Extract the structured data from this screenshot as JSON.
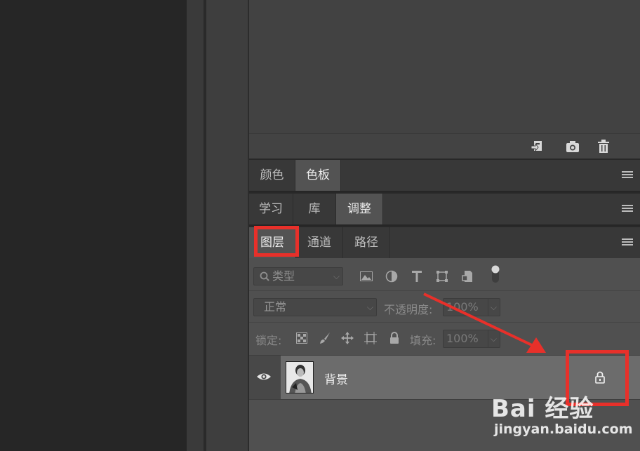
{
  "history_footer": {
    "icons": [
      "new-snapshot-icon",
      "camera-icon",
      "trash-icon"
    ]
  },
  "tabs_color": {
    "items": [
      "颜色",
      "色板"
    ],
    "active": "色板"
  },
  "tabs_learn": {
    "items": [
      "学习",
      "库",
      "调整"
    ],
    "active": "调整"
  },
  "tabs_layers": {
    "items": [
      "图层",
      "通道",
      "路径"
    ],
    "active": "图层"
  },
  "filter": {
    "kind_placeholder": "类型",
    "icons": [
      "image-filter-icon",
      "adjustment-filter-icon",
      "type-filter-icon",
      "shape-filter-icon",
      "smart-object-filter-icon",
      "filter-toggle-icon"
    ]
  },
  "blend": {
    "mode": "正常",
    "opacity_label": "不透明度:",
    "opacity_value": "100%"
  },
  "lock": {
    "label": "锁定:",
    "icons": [
      "lock-transparent-pixels-icon",
      "lock-image-pixels-icon",
      "lock-position-icon",
      "lock-artboard-icon",
      "lock-all-icon"
    ],
    "fill_label": "填充:",
    "fill_value": "100%"
  },
  "layer": {
    "name": "背景",
    "visibility_icon": "eye-icon",
    "lock_icon": "padlock-icon"
  },
  "watermark": {
    "logo": "Bai 经验",
    "url": "jingyan.baidu.com"
  },
  "colors": {
    "annotation_red": "#e8302a",
    "panel_bg": "#505050",
    "selected_layer": "#6c6c6c"
  }
}
